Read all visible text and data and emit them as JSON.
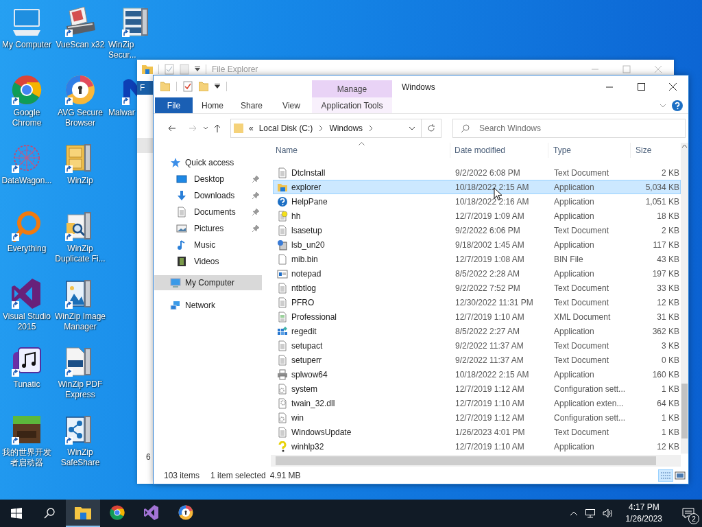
{
  "desktop_icon_rows": [
    [
      {
        "label": "My Computer",
        "kind": "computer",
        "shortcut": false
      },
      {
        "label": "VueScan x32",
        "kind": "scanner",
        "shortcut": true
      },
      {
        "label": "WinZip Secur...",
        "kind": "winzip-secure",
        "shortcut": true
      }
    ],
    [
      {
        "label": "Google Chrome",
        "kind": "chrome",
        "shortcut": true
      },
      {
        "label": "AVG Secure Browser",
        "kind": "avg",
        "shortcut": true
      },
      {
        "label": "Malwar",
        "kind": "malware",
        "shortcut": true
      }
    ],
    [
      {
        "label": "DataWagon...",
        "kind": "datawagon",
        "shortcut": true
      },
      {
        "label": "WinZip",
        "kind": "winzip",
        "shortcut": true
      }
    ],
    [
      {
        "label": "Everything",
        "kind": "everything",
        "shortcut": true
      },
      {
        "label": "WinZip Duplicate Fi...",
        "kind": "winzip-search",
        "shortcut": true
      }
    ],
    [
      {
        "label": "Visual Studio 2015",
        "kind": "vs",
        "shortcut": true
      },
      {
        "label": "WinZip Image Manager",
        "kind": "winzip-image",
        "shortcut": true
      }
    ],
    [
      {
        "label": "Tunatic",
        "kind": "tunatic",
        "shortcut": true
      },
      {
        "label": "WinZip PDF Express",
        "kind": "winzip-pdf",
        "shortcut": true
      }
    ],
    [
      {
        "label": "我的世界开发者启动器",
        "kind": "minecraft",
        "shortcut": true
      },
      {
        "label": "WinZip SafeShare",
        "kind": "winzip-share",
        "shortcut": true
      }
    ]
  ],
  "back_window": {
    "title": "File Explorer",
    "tab": "F",
    "status": "6"
  },
  "explorer": {
    "title": "Windows",
    "ribbon_tabs": [
      {
        "label": "File",
        "kind": "file"
      },
      {
        "label": "Home",
        "kind": "plain"
      },
      {
        "label": "Share",
        "kind": "plain"
      },
      {
        "label": "View",
        "kind": "plain"
      },
      {
        "label": "Application Tools",
        "kind": "contextual",
        "group": "Manage"
      }
    ],
    "address": {
      "overflow": "«",
      "crumbs": [
        "Local Disk (C:)",
        "Windows"
      ]
    },
    "search": {
      "placeholder": "Search Windows"
    },
    "nav": [
      {
        "label": "Quick access",
        "kind": "star",
        "selected": false,
        "children": [
          {
            "label": "Desktop",
            "kind": "desktop",
            "pinned": true,
            "selected": false
          },
          {
            "label": "Downloads",
            "kind": "downloads",
            "pinned": true,
            "selected": false
          },
          {
            "label": "Documents",
            "kind": "documents",
            "pinned": true,
            "selected": false
          },
          {
            "label": "Pictures",
            "kind": "pictures",
            "pinned": true,
            "selected": false
          },
          {
            "label": "Music",
            "kind": "music",
            "pinned": false,
            "selected": false
          },
          {
            "label": "Videos",
            "kind": "videos",
            "pinned": false,
            "selected": false
          }
        ]
      },
      {
        "label": "My Computer",
        "kind": "computer",
        "selected": true
      },
      {
        "label": "Network",
        "kind": "network",
        "selected": false
      }
    ],
    "columns": [
      {
        "label": "Name",
        "sorted": true
      },
      {
        "label": "Date modified",
        "sorted": false
      },
      {
        "label": "Type",
        "sorted": false
      },
      {
        "label": "Size",
        "sorted": false
      }
    ],
    "rows": [
      {
        "kind": "text",
        "name": "DtcInstall",
        "date": "9/2/2022 6:08 PM",
        "type": "Text Document",
        "size": "2 KB",
        "selected": false
      },
      {
        "kind": "explorer",
        "name": "explorer",
        "date": "10/18/2022 2:15 AM",
        "type": "Application",
        "size": "5,034 KB",
        "selected": true
      },
      {
        "kind": "help",
        "name": "HelpPane",
        "date": "10/18/2022 2:16 AM",
        "type": "Application",
        "size": "1,051 KB",
        "selected": false
      },
      {
        "kind": "hh",
        "name": "hh",
        "date": "12/7/2019 1:09 AM",
        "type": "Application",
        "size": "18 KB",
        "selected": false
      },
      {
        "kind": "text",
        "name": "lsasetup",
        "date": "9/2/2022 6:06 PM",
        "type": "Text Document",
        "size": "2 KB",
        "selected": false
      },
      {
        "kind": "installer",
        "name": "lsb_un20",
        "date": "9/18/2002 1:45 AM",
        "type": "Application",
        "size": "117 KB",
        "selected": false
      },
      {
        "kind": "blank",
        "name": "mib.bin",
        "date": "12/7/2019 1:08 AM",
        "type": "BIN File",
        "size": "43 KB",
        "selected": false
      },
      {
        "kind": "notepad",
        "name": "notepad",
        "date": "8/5/2022 2:28 AM",
        "type": "Application",
        "size": "197 KB",
        "selected": false
      },
      {
        "kind": "text",
        "name": "ntbtlog",
        "date": "9/2/2022 7:52 PM",
        "type": "Text Document",
        "size": "33 KB",
        "selected": false
      },
      {
        "kind": "text",
        "name": "PFRO",
        "date": "12/30/2022 11:31 PM",
        "type": "Text Document",
        "size": "12 KB",
        "selected": false
      },
      {
        "kind": "xml",
        "name": "Professional",
        "date": "12/7/2019 1:10 AM",
        "type": "XML Document",
        "size": "31 KB",
        "selected": false
      },
      {
        "kind": "regedit",
        "name": "regedit",
        "date": "8/5/2022 2:27 AM",
        "type": "Application",
        "size": "362 KB",
        "selected": false
      },
      {
        "kind": "text",
        "name": "setupact",
        "date": "9/2/2022 11:37 AM",
        "type": "Text Document",
        "size": "3 KB",
        "selected": false
      },
      {
        "kind": "text",
        "name": "setuperr",
        "date": "9/2/2022 11:37 AM",
        "type": "Text Document",
        "size": "0 KB",
        "selected": false
      },
      {
        "kind": "printer",
        "name": "splwow64",
        "date": "10/18/2022 2:15 AM",
        "type": "Application",
        "size": "160 KB",
        "selected": false
      },
      {
        "kind": "config",
        "name": "system",
        "date": "12/7/2019 1:12 AM",
        "type": "Configuration sett...",
        "size": "1 KB",
        "selected": false
      },
      {
        "kind": "dll",
        "name": "twain_32.dll",
        "date": "12/7/2019 1:10 AM",
        "type": "Application exten...",
        "size": "64 KB",
        "selected": false
      },
      {
        "kind": "config",
        "name": "win",
        "date": "12/7/2019 1:12 AM",
        "type": "Configuration sett...",
        "size": "1 KB",
        "selected": false
      },
      {
        "kind": "text",
        "name": "WindowsUpdate",
        "date": "1/26/2023 4:01 PM",
        "type": "Text Document",
        "size": "1 KB",
        "selected": false
      },
      {
        "kind": "winhelp",
        "name": "winhlp32",
        "date": "12/7/2019 1:10 AM",
        "type": "Application",
        "size": "12 KB",
        "selected": false
      }
    ],
    "status": {
      "count": "103 items",
      "selection": "1 item selected",
      "size": "4.91 MB"
    }
  },
  "taskbar": {
    "apps": [
      {
        "kind": "explorer",
        "active": true
      },
      {
        "kind": "chrome",
        "active": false
      },
      {
        "kind": "vs",
        "active": false
      },
      {
        "kind": "avg",
        "active": false
      }
    ],
    "time": "4:17 PM",
    "date": "1/26/2023",
    "notifications": "2"
  }
}
